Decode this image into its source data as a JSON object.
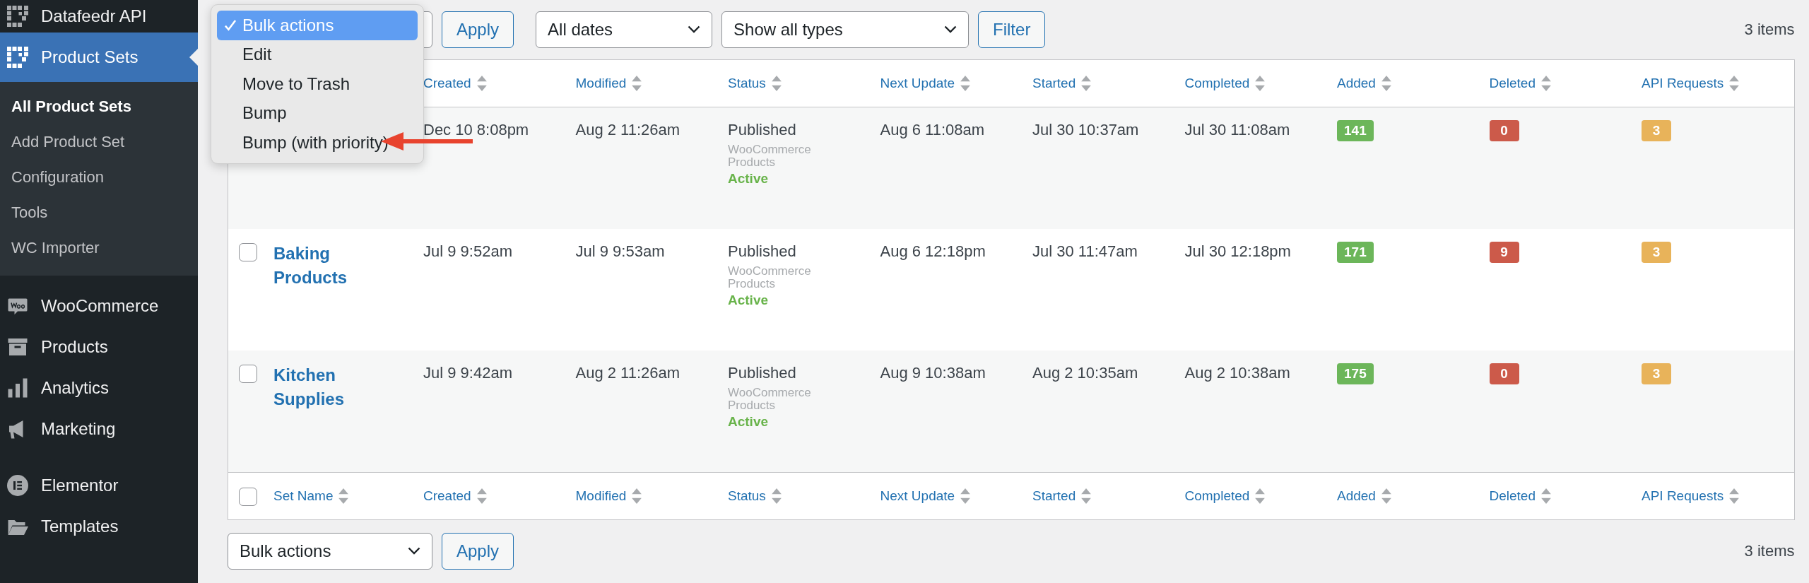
{
  "sidebar": {
    "items": [
      {
        "label": "Datafeedr API",
        "selected": false
      },
      {
        "label": "Product Sets",
        "selected": true,
        "children": [
          {
            "label": "All Product Sets",
            "selected": true
          },
          {
            "label": "Add Product Set",
            "selected": false
          },
          {
            "label": "Configuration",
            "selected": false
          },
          {
            "label": "Tools",
            "selected": false
          },
          {
            "label": "WC Importer",
            "selected": false
          }
        ]
      },
      {
        "label": "WooCommerce",
        "selected": false
      },
      {
        "label": "Products",
        "selected": false
      },
      {
        "label": "Analytics",
        "selected": false
      },
      {
        "label": "Marketing",
        "selected": false
      },
      {
        "label": "Elementor",
        "selected": false
      },
      {
        "label": "Templates",
        "selected": false
      }
    ]
  },
  "top_toolbar": {
    "apply": "Apply",
    "date_filter": "All dates",
    "type_filter": "Show all types",
    "filter": "Filter",
    "count": "3 items"
  },
  "bulk_menu": {
    "options": [
      {
        "label": "Bulk actions",
        "selected": true,
        "marked": false
      },
      {
        "label": "Edit",
        "selected": false,
        "marked": false
      },
      {
        "label": "Move to Trash",
        "selected": false,
        "marked": false
      },
      {
        "label": "Bump",
        "selected": false,
        "marked": false
      },
      {
        "label": "Bump (with priority)",
        "selected": false,
        "marked": true
      }
    ]
  },
  "table": {
    "columns": [
      "Created",
      "Modified",
      "Status",
      "Next Update",
      "Started",
      "Completed",
      "Added",
      "Deleted",
      "API Requests"
    ],
    "footer_columns": [
      "Set Name",
      "Created",
      "Modified",
      "Status",
      "Next Update",
      "Started",
      "Completed",
      "Added",
      "Deleted",
      "API Requests"
    ],
    "rows": [
      {
        "created": "Dec 10 8:08pm",
        "modified": "Aug 2 11:26am",
        "status": "Published",
        "type": "WooCommerce Products",
        "state": "Active",
        "next_update": "Aug 6 11:08am",
        "started": "Jul 30 10:37am",
        "completed": "Jul 30 11:08am",
        "added": "141",
        "deleted": "0",
        "api_requests": "3"
      },
      {
        "checked": false,
        "name": "Baking Products",
        "created": "Jul 9 9:52am",
        "modified": "Jul 9 9:53am",
        "status": "Published",
        "type": "WooCommerce Products",
        "state": "Active",
        "next_update": "Aug 6 12:18pm",
        "started": "Jul 30 11:47am",
        "completed": "Jul 30 12:18pm",
        "added": "171",
        "deleted": "9",
        "api_requests": "3"
      },
      {
        "checked": false,
        "name": "Kitchen Supplies",
        "created": "Jul 9 9:42am",
        "modified": "Aug 2 11:26am",
        "status": "Published",
        "type": "WooCommerce Products",
        "state": "Active",
        "next_update": "Aug 9 10:38am",
        "started": "Aug 2 10:35am",
        "completed": "Aug 2 10:38am",
        "added": "175",
        "deleted": "0",
        "api_requests": "3"
      }
    ],
    "footer_checked": false
  },
  "bottom_toolbar": {
    "bulk_actions": "Bulk actions",
    "apply": "Apply",
    "count": "3 items"
  }
}
